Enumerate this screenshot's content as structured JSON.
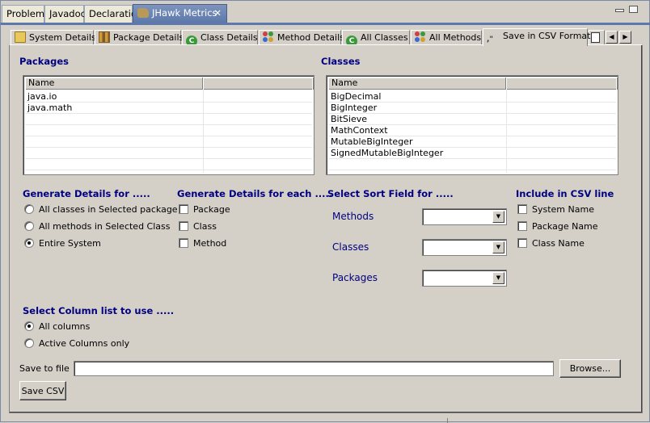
{
  "view_tabs": [
    {
      "label": "Problems"
    },
    {
      "label": "Javadoc"
    },
    {
      "label": "Declaration"
    },
    {
      "label": "JHawk Metrics",
      "active": true
    }
  ],
  "inner_tabs": [
    {
      "label": "System Details",
      "icon": "folder-icon"
    },
    {
      "label": "Package Details",
      "icon": "package-icon"
    },
    {
      "label": "Class Details",
      "icon": "class-icon"
    },
    {
      "label": "Method Details",
      "icon": "method-icon"
    },
    {
      "label": "All Classes",
      "icon": "class-icon"
    },
    {
      "label": "All Methods",
      "icon": "method-icon"
    },
    {
      "label": "Save in CSV Format",
      "icon": "csv-icon",
      "active": true
    }
  ],
  "packages": {
    "heading": "Packages",
    "column": "Name",
    "rows": [
      "java.io",
      "java.math",
      "",
      "",
      "",
      "",
      ""
    ]
  },
  "classes": {
    "heading": "Classes",
    "column": "Name",
    "rows": [
      "BigDecimal",
      "BigInteger",
      "BitSieve",
      "MathContext",
      "MutableBigInteger",
      "SignedMutableBigInteger",
      ""
    ]
  },
  "generate_for": {
    "heading": "Generate Details for .....",
    "options": [
      {
        "label": "All classes in Selected package",
        "selected": false
      },
      {
        "label": "All methods in Selected Class",
        "selected": false
      },
      {
        "label": "Entire System",
        "selected": true
      }
    ]
  },
  "generate_each": {
    "heading": "Generate Details for each .....",
    "options": [
      {
        "label": "Package",
        "checked": false
      },
      {
        "label": "Class",
        "checked": false
      },
      {
        "label": "Method",
        "checked": false
      }
    ]
  },
  "sort_field": {
    "heading": "Select Sort Field for .....",
    "rows": [
      {
        "label": "Methods",
        "value": ""
      },
      {
        "label": "Classes",
        "value": ""
      },
      {
        "label": "Packages",
        "value": ""
      }
    ]
  },
  "include_csv": {
    "heading": "Include in CSV line",
    "options": [
      {
        "label": "System Name",
        "checked": false
      },
      {
        "label": "Package Name",
        "checked": false
      },
      {
        "label": "Class Name",
        "checked": false
      }
    ]
  },
  "column_list": {
    "heading": "Select Column list to use .....",
    "options": [
      {
        "label": "All columns",
        "selected": true
      },
      {
        "label": "Active Columns only",
        "selected": false
      }
    ]
  },
  "save": {
    "label": "Save to file",
    "value": "",
    "browse_label": "Browse...",
    "save_label": "Save CSV"
  }
}
